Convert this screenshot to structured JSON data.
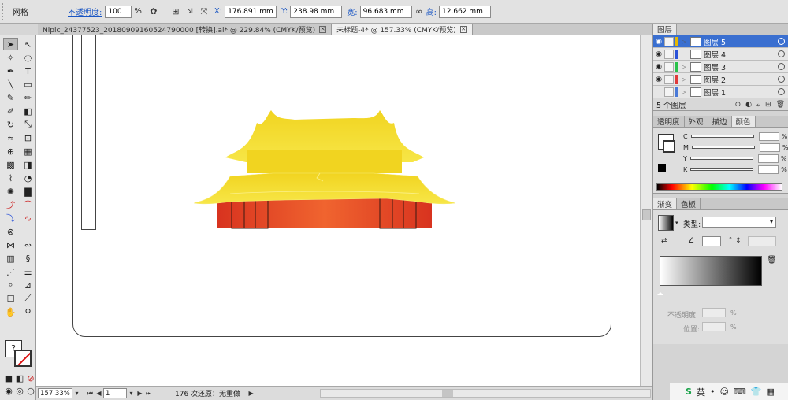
{
  "control_bar": {
    "mode_label": "网格",
    "opacity_label": "不透明度:",
    "opacity_value": "100",
    "opacity_unit": "%",
    "x_label": "X:",
    "x_value": "176.891 mm",
    "y_label": "Y:",
    "y_value": "238.98 mm",
    "w_label": "宽:",
    "w_value": "96.683 mm",
    "h_label": "高:",
    "h_value": "12.662 mm"
  },
  "tabs": [
    {
      "label": "Nipic_24377523_20180909160524790000 [转换].ai* @ 229.84% (CMYK/预览)",
      "active": false
    },
    {
      "label": "未标题-4* @ 157.33% (CMYK/预览)",
      "active": true
    }
  ],
  "status_bar": {
    "zoom": "157.33%",
    "artboard": "1",
    "history": "176 次还原：无重做"
  },
  "layers_panel": {
    "tab": "图层",
    "layers": [
      {
        "name": "图层 5",
        "color": "#e6b800",
        "selected": true
      },
      {
        "name": "图层 4",
        "color": "#2a52d8",
        "selected": false
      },
      {
        "name": "图层 3",
        "color": "#29c24a",
        "selected": false
      },
      {
        "name": "图层 2",
        "color": "#e03a3a",
        "selected": false
      },
      {
        "name": "图层 1",
        "color": "#4a7ad8",
        "selected": false
      }
    ],
    "count_label": "5 个图层"
  },
  "color_panel": {
    "tabs": [
      "透明度",
      "外观",
      "描边",
      "颜色"
    ],
    "channels": [
      "C",
      "M",
      "Y",
      "K"
    ],
    "unit": "%"
  },
  "gradient_panel": {
    "tabs": [
      "渐变",
      "色板"
    ],
    "type_label": "类型:",
    "opacity_label": "不透明度:",
    "position_label": "位置:",
    "unit": "%"
  },
  "ime": {
    "label": "英"
  },
  "colors": {
    "roof": "#f3dc2a",
    "roof_light": "#f7ec5a",
    "wall": "#e9432b",
    "wall_dark": "#c9321d",
    "selection_blue": "#3a6fd0"
  }
}
